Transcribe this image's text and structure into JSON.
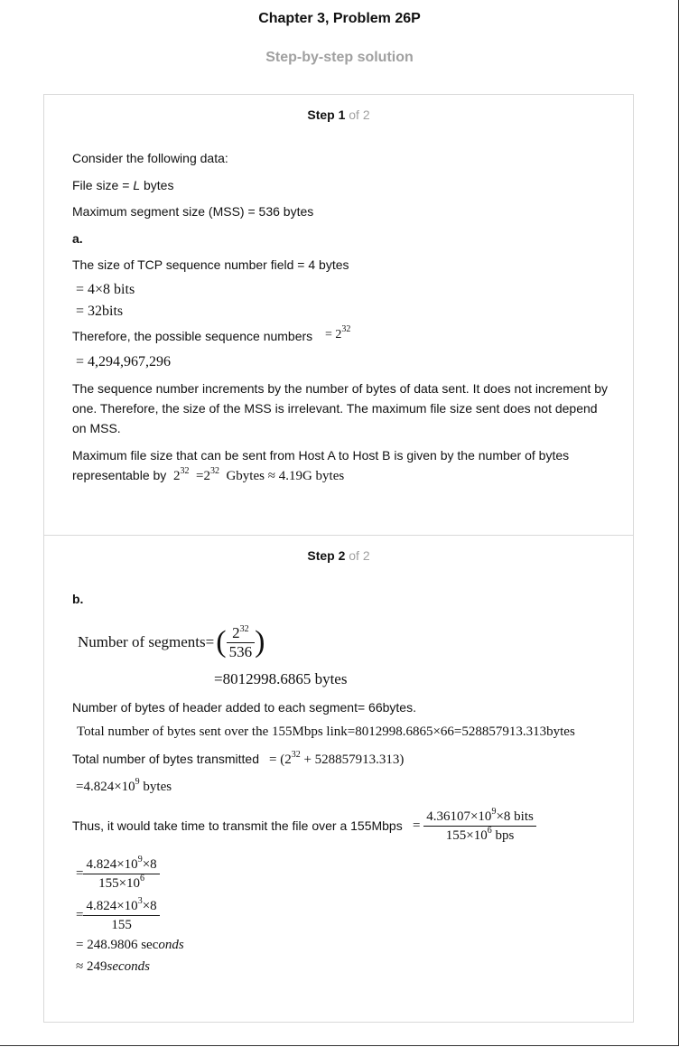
{
  "header": {
    "title": "Chapter 3, Problem 26P",
    "subtitle": "Step-by-step solution"
  },
  "step1": {
    "label": "Step 1",
    "of": "of 2",
    "lines": {
      "consider": "Consider the following data:",
      "file_size_prefix": "File size = ",
      "file_size_var": "L",
      "file_size_suffix": " bytes",
      "mss": "Maximum segment size (MSS) = 536 bytes",
      "part_a": "a.",
      "tcp_field": "The size of TCP sequence number field = 4 bytes",
      "eq1": "= 4×8 bits",
      "eq2": "= 32bits",
      "therefore": "Therefore, the possible sequence numbers",
      "eq3_base": "= 2",
      "eq3_exp": "32",
      "eq4": "= 4,294,967,296",
      "seq_para": "The sequence number increments by the number of bytes of data sent. It does not increment by one. Therefore, the size of the MSS is irrelevant. The maximum file size sent does not depend on MSS.",
      "maxfile_line1": "Maximum file size that can be sent from Host A to Host B is given by the number of bytes",
      "maxfile_line2": "representable by",
      "eq5_a": "2",
      "eq5_a_exp": "32",
      "eq5_b": "=2",
      "eq5_b_exp": "32",
      "eq5_c": "Gbytes ≈ 4.19G bytes"
    }
  },
  "step2": {
    "label": "Step 2",
    "of": "of 2",
    "lines": {
      "part_b": "b.",
      "segments_label": "Number of segments=",
      "seg_num_base": "2",
      "seg_num_exp": "32",
      "seg_den": "536",
      "seg_result": "=8012998.6865 bytes",
      "header_bytes": "Number of bytes of header added to each segment= 66bytes.",
      "total_sent": "Total number of bytes sent over the 155Mbps link=8012998.6865×66=528857913.313bytes",
      "total_trans": "Total number of bytes transmitted",
      "tt_open": "= (2",
      "tt_exp": "32",
      "tt_rest": " + 528857913.313)",
      "tt_res_base": "=4.824×10",
      "tt_res_exp": "9",
      "tt_res_unit": " bytes",
      "thus": "Thus, it would take time to transmit the file over a 155Mbps",
      "f1_num_a": "4.36107×10",
      "f1_num_exp": "9",
      "f1_num_b": "×8 bits",
      "f1_den_a": "155×10",
      "f1_den_exp": "6",
      "f1_den_b": " bps",
      "f2_num_a": "4.824×10",
      "f2_num_exp": "9",
      "f2_num_b": "×8",
      "f2_den_a": "155×10",
      "f2_den_exp": "6",
      "f3_num_a": "4.824×10",
      "f3_num_exp": "3",
      "f3_num_b": "×8",
      "f3_den": "155",
      "r1_a": "= 248.9806 sec",
      "r1_b": "onds",
      "r2_a": "≈ 249",
      "r2_b": "seconds"
    }
  }
}
